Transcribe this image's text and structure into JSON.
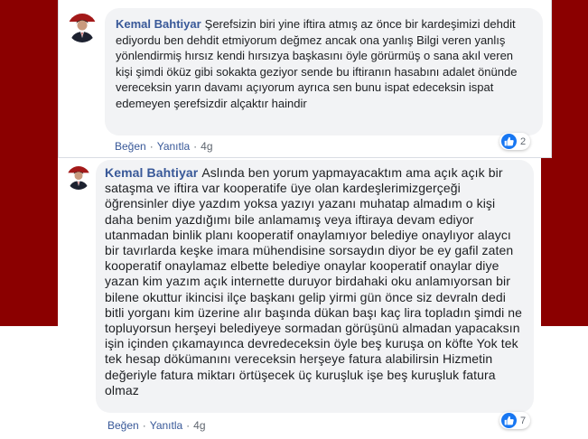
{
  "comments": [
    {
      "author": "Kemal Bahtiyar",
      "text": "Şerefsizin biri yine iftira atmış az önce bir kardeşimizi dehdit ediyordu ben dehdit etmiyorum değmez ancak ona yanlış Bilgi veren yanlış yönlendirmiş hırsız kendi hırsızya başkasını öyle görürmüş o sana akıl veren kişi şimdi öküz gibi sokakta geziyor sende bu iftiranın hasabını adalet önünde vereceksin yarın davamı açıyorum ayrıca sen bunu ispat edeceksin ispat edemeyen şerefsizdir alçaktır haindir",
      "like_label": "Beğen",
      "reply_label": "Yanıtla",
      "time": "4g",
      "reaction_count": "2",
      "reaction_icon": "thumbs-up-icon"
    },
    {
      "author": "Kemal Bahtiyar",
      "text": "Aslında ben yorum yapmayacaktım ama açık açık bir sataşma ve iftira var kooperatife üye olan kardeşlerimizgerçeği öğrensinler diye yazdım yoksa yazıyı yazanı muhatap almadım o kişi daha benim yazdığımı bile anlamamış veya iftiraya devam ediyor utanmadan binlik planı kooperatif onaylamıyor belediye onaylıyor alaycı bir tavırlarda keşke imara mühendisine sorsaydın diyor be ey gafil zaten kooperatif onaylamaz elbette belediye onaylar kooperatif onaylar diye yazan kim yazım açık internette duruyor birdahaki oku anlamıyorsan bir bilene okuttur ikincisi ilçe başkanı gelip yirmi gün önce siz devraln dedi bitli yorganı kim üzerine alır başında dükan başı kaç lira topladın şimdi ne topluyorsun herşeyi belediyeye sormadan görüşünü almadan yapacaksın işin içinden çıkamayınca devredeceksin öyle beş kuruşa on köfte Yok tek tek hesap dökümanını vereceksin herşeye fatura alabilirsin Hizmetin değeriyle fatura miktarı örtüşecek üç kuruşluk işe beş kuruşluk fatura olmaz",
      "like_label": "Beğen",
      "reply_label": "Yanıtla",
      "time": "4g",
      "reaction_count": "7",
      "reaction_icon": "thumbs-up-icon"
    }
  ],
  "colors": {
    "frame": "#8b0000",
    "author": "#385898",
    "bubble": "#f2f3f5",
    "like_blue": "#1877f2"
  }
}
